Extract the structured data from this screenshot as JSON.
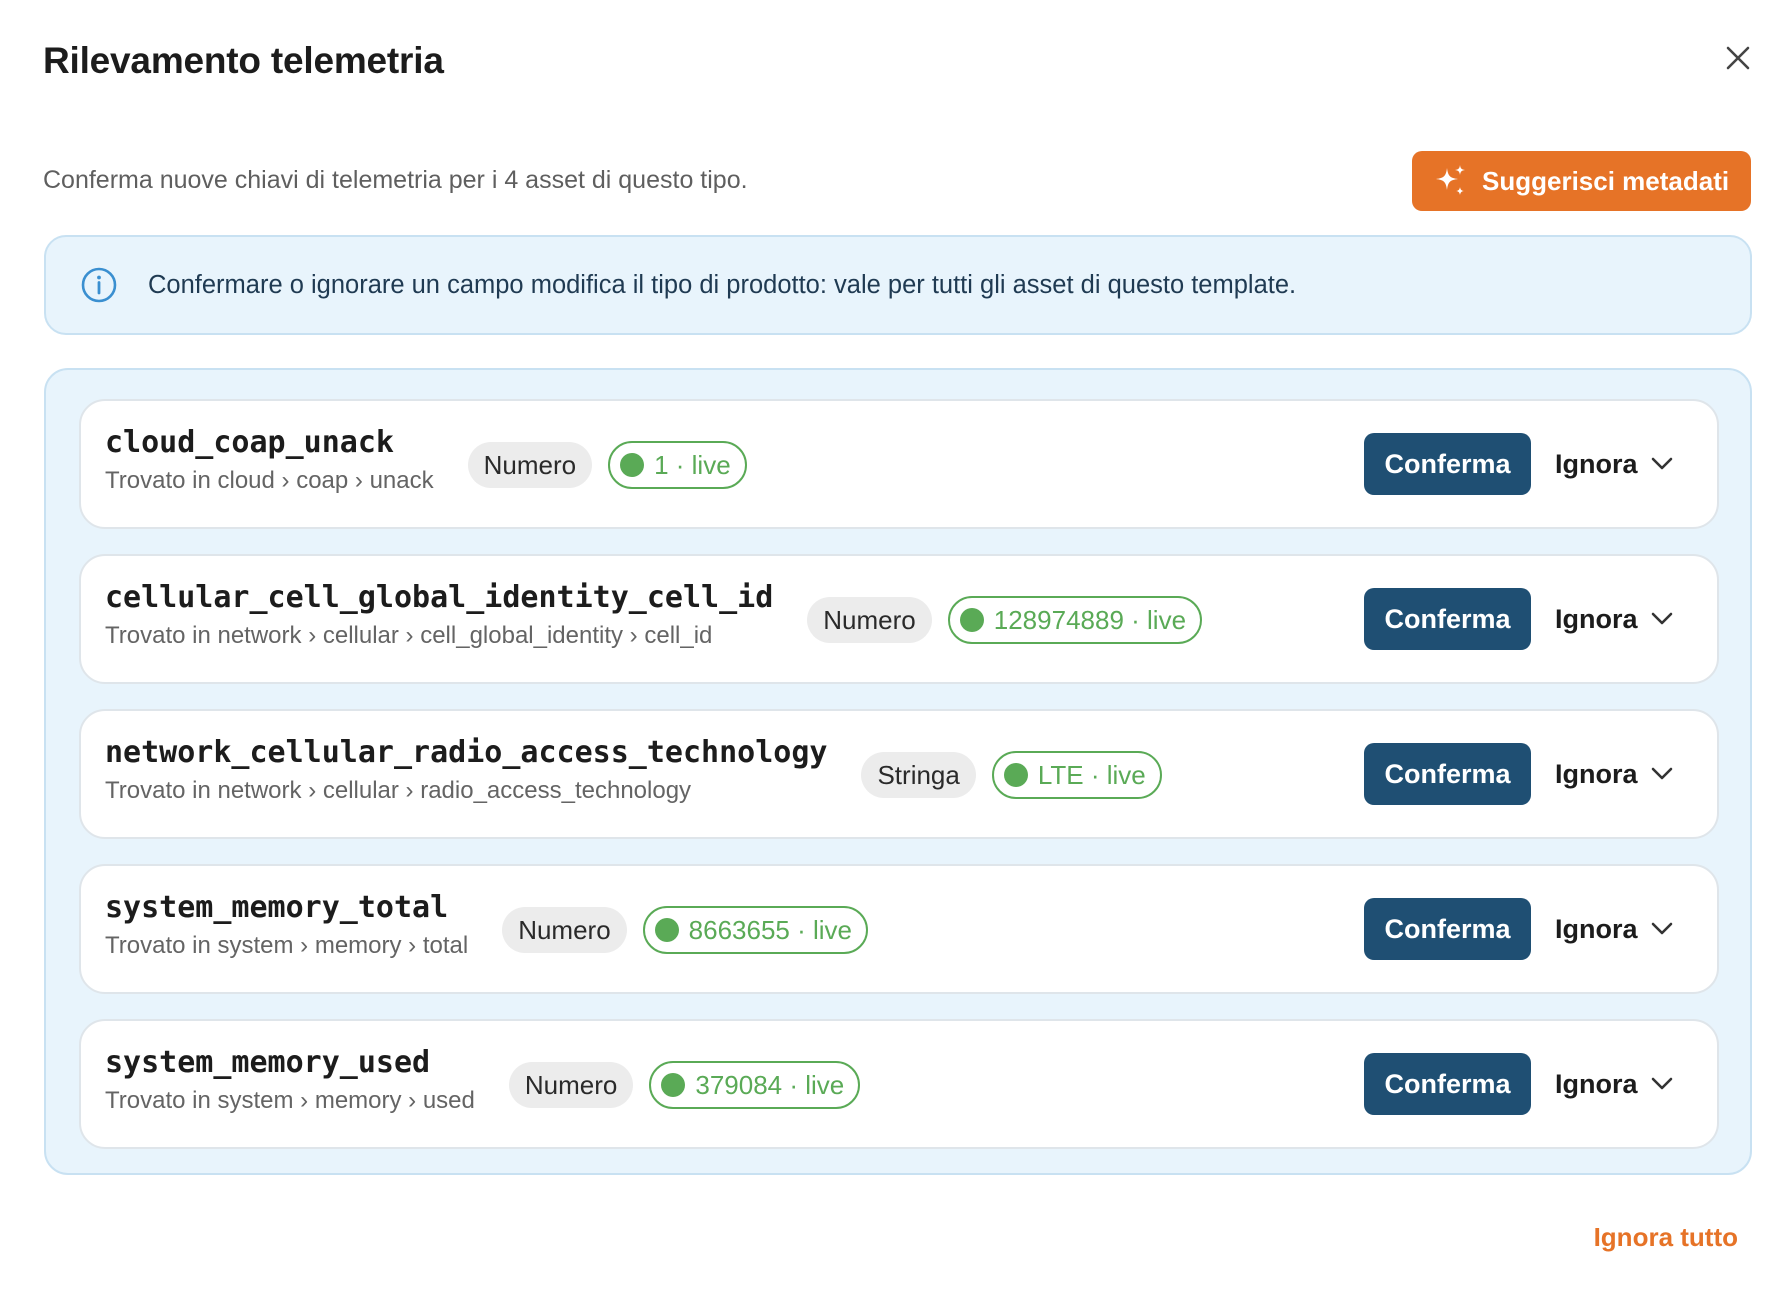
{
  "dialog": {
    "title": "Rilevamento telemetria",
    "subtitle": "Conferma nuove chiavi di telemetria per i 4 asset di questo tipo.",
    "suggest_label": "Suggerisci metadati",
    "info_text": "Confermare o ignorare un campo modifica il tipo di prodotto: vale per tutti gli asset di questo template.",
    "ignore_all_label": "Ignora tutto"
  },
  "colors": {
    "accent_orange": "#e67327",
    "confirm_blue": "#1f4f73",
    "live_green": "#5aaa56",
    "panel_bg": "#e8f4fc"
  },
  "icons": {
    "close": "close-icon",
    "suggest": "sparkles-icon",
    "info": "info-icon",
    "expand": "chevron-down-icon"
  },
  "rows": [
    {
      "key": "cloud_coap_unack",
      "path": "Trovato in cloud › coap › unack",
      "type": "Numero",
      "live": "1 · live",
      "confirm": "Conferma",
      "ignore": "Ignora"
    },
    {
      "key": "cellular_cell_global_identity_cell_id",
      "path": "Trovato in network › cellular › cell_global_identity › cell_id",
      "type": "Numero",
      "live": "128974889 · live",
      "confirm": "Conferma",
      "ignore": "Ignora"
    },
    {
      "key": "network_cellular_radio_access_technology",
      "path": "Trovato in network › cellular › radio_access_technology",
      "type": "Stringa",
      "live": "LTE · live",
      "confirm": "Conferma",
      "ignore": "Ignora"
    },
    {
      "key": "system_memory_total",
      "path": "Trovato in system › memory › total",
      "type": "Numero",
      "live": "8663655 · live",
      "confirm": "Conferma",
      "ignore": "Ignora"
    },
    {
      "key": "system_memory_used",
      "path": "Trovato in system › memory › used",
      "type": "Numero",
      "live": "379084 · live",
      "confirm": "Conferma",
      "ignore": "Ignora"
    }
  ]
}
